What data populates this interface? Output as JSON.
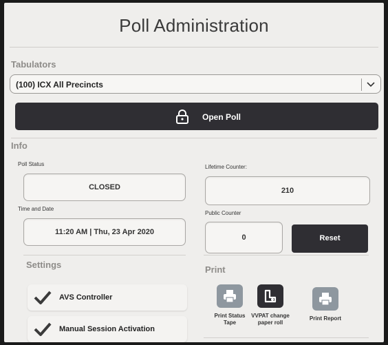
{
  "title": "Poll Administration",
  "tabulators": {
    "section_label": "Tabulators",
    "selected": "(100) ICX All Precincts"
  },
  "open_poll_label": "Open Poll",
  "info": {
    "section_label": "Info",
    "poll_status_label": "Poll Status",
    "poll_status_value": "CLOSED",
    "time_date_label": "Time and Date",
    "time_date_value": "11:20 AM | Thu, 23 Apr 2020",
    "lifetime_counter_label": "Lifetime Counter:",
    "lifetime_counter_value": "210",
    "public_counter_label": "Public Counter",
    "public_counter_value": "0",
    "reset_label": "Reset"
  },
  "settings": {
    "section_label": "Settings",
    "items": [
      {
        "label": "AVS Controller",
        "checked": true
      },
      {
        "label": "Manual Session Activation",
        "checked": true
      }
    ]
  },
  "print": {
    "section_label": "Print",
    "items": [
      {
        "label_line1": "Print Status",
        "label_line2": "Tape",
        "icon": "printer-icon"
      },
      {
        "label_line1": "VVPAT change",
        "label_line2": "paper roll",
        "icon": "paper-roll-icon"
      },
      {
        "label_line1": "Print Report",
        "label_line2": "",
        "icon": "printer-icon"
      }
    ]
  },
  "colors": {
    "dark_button": "#2f2e33",
    "tile_gray": "#8e979f",
    "tile_dark": "#2f2e33",
    "background": "#efeeec"
  }
}
